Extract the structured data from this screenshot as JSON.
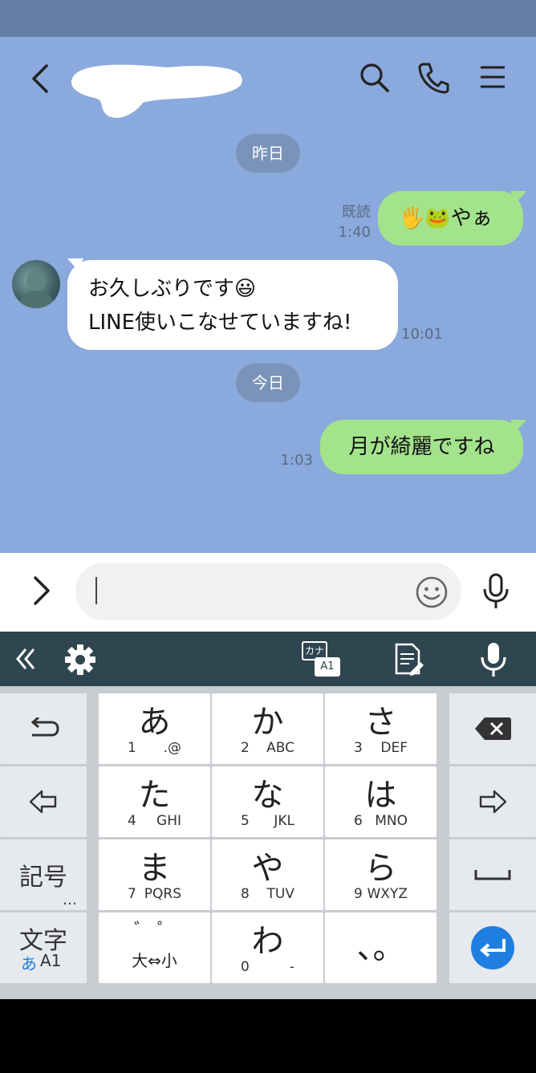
{
  "header": {
    "back_icon": "chevron-left-icon",
    "search_icon": "search-icon",
    "call_icon": "phone-icon",
    "menu_icon": "hamburger-menu-icon"
  },
  "messages": [
    {
      "type": "date",
      "label": "昨日"
    },
    {
      "type": "sent",
      "text": "🖐🐸やぁ",
      "read": "既読",
      "time": "1:40"
    },
    {
      "type": "received",
      "line1": "お久しぶりです😃",
      "line2": "LINE使いこなせていますね!",
      "time": "10:01"
    },
    {
      "type": "date",
      "label": "今日"
    },
    {
      "type": "sent",
      "text": "月が綺麗ですね",
      "time": "1:03"
    }
  ],
  "input": {
    "placeholder": ""
  },
  "toolbar": {
    "kana_label": "カナ",
    "a1_label": "A1"
  },
  "keyboard": {
    "keys": [
      {
        "kana": "あ",
        "num": "1",
        "alpha": ".@"
      },
      {
        "kana": "か",
        "num": "2",
        "alpha": "ABC"
      },
      {
        "kana": "さ",
        "num": "3",
        "alpha": "DEF"
      },
      {
        "kana": "た",
        "num": "4",
        "alpha": "GHI"
      },
      {
        "kana": "な",
        "num": "5",
        "alpha": "JKL"
      },
      {
        "kana": "は",
        "num": "6",
        "alpha": "MNO"
      },
      {
        "kana": "ま",
        "num": "7",
        "alpha": "PQRS"
      },
      {
        "kana": "や",
        "num": "8",
        "alpha": "TUV"
      },
      {
        "kana": "ら",
        "num": "9",
        "alpha": "WXYZ"
      },
      {
        "kana": "゛ ゜",
        "sub": "大⇔小"
      },
      {
        "kana": "わ",
        "num": "0",
        "alpha": "-"
      },
      {
        "kana": "、。"
      }
    ],
    "symbol_label": "記号",
    "symbol_dots": "…",
    "mode_label": "文字",
    "mode_sub_a": "あ",
    "mode_sub_b": "A1"
  },
  "colors": {
    "chat_bg": "#8aa9dc",
    "sent_bubble": "#a3e38c",
    "enter_key": "#1f7fe0"
  }
}
